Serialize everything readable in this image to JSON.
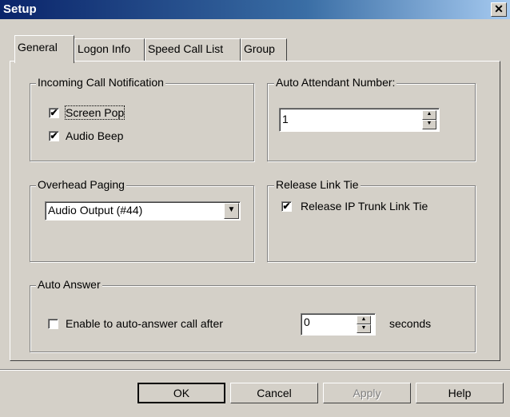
{
  "window": {
    "title": "Setup",
    "close_glyph": "✕"
  },
  "tabs": [
    {
      "label": "General",
      "active": true
    },
    {
      "label": "Logon Info",
      "active": false
    },
    {
      "label": "Speed Call List",
      "active": false
    },
    {
      "label": "Group",
      "active": false
    }
  ],
  "incoming": {
    "legend": "Incoming Call Notification",
    "screen_pop": {
      "label": "Screen Pop",
      "checked": true
    },
    "audio_beep": {
      "label": "Audio Beep",
      "checked": true
    }
  },
  "auto_attendant": {
    "legend": "Auto Attendant Number:",
    "value": "1"
  },
  "overhead": {
    "legend": "Overhead Paging",
    "selected": "Audio Output (#44)"
  },
  "release": {
    "legend": "Release Link Tie",
    "release_ip": {
      "label": "Release IP Trunk Link Tie",
      "checked": true
    }
  },
  "auto_answer": {
    "legend": "Auto Answer",
    "enable": {
      "label": "Enable to auto-answer call after",
      "checked": false
    },
    "seconds_value": "0",
    "seconds_label": "seconds"
  },
  "buttons": {
    "ok": "OK",
    "cancel": "Cancel",
    "apply": "Apply",
    "help": "Help"
  },
  "check_glyph": "✔",
  "colors": {
    "dialog_bg": "#d4d0c8",
    "titlebar": "#0a246a"
  }
}
